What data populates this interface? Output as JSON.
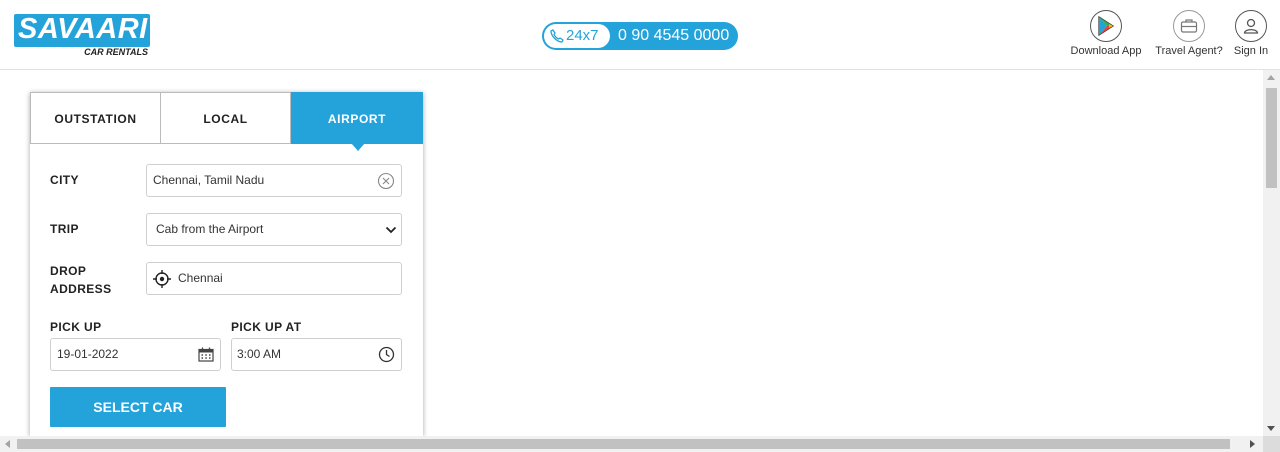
{
  "header": {
    "logo": {
      "name": "SAVAARI",
      "tagline": "CAR RENTALS"
    },
    "phone": {
      "tag": "24x7",
      "number": "0 90 4545 0000"
    },
    "actions": [
      {
        "label": "Download App",
        "icon": "play-store-icon"
      },
      {
        "label": "Travel Agent?",
        "icon": "briefcase-icon"
      },
      {
        "label": "Sign In",
        "icon": "user-icon"
      }
    ]
  },
  "booking": {
    "tabs": [
      {
        "label": "OUTSTATION",
        "active": false
      },
      {
        "label": "LOCAL",
        "active": false
      },
      {
        "label": "AIRPORT",
        "active": true
      }
    ],
    "city": {
      "label": "CITY",
      "value": "Chennai, Tamil Nadu"
    },
    "trip": {
      "label": "TRIP",
      "value": "Cab from the Airport"
    },
    "drop": {
      "label_line1": "DROP",
      "label_line2": "ADDRESS",
      "value": "Chennai"
    },
    "pickup": {
      "label": "PICK UP",
      "value": "19-01-2022"
    },
    "pickup_at": {
      "label": "PICK UP AT",
      "value": "3:00 AM"
    },
    "submit_label": "SELECT CAR"
  },
  "colors": {
    "accent": "#24a3db",
    "text": "#222222",
    "border": "#cfcfcf"
  }
}
